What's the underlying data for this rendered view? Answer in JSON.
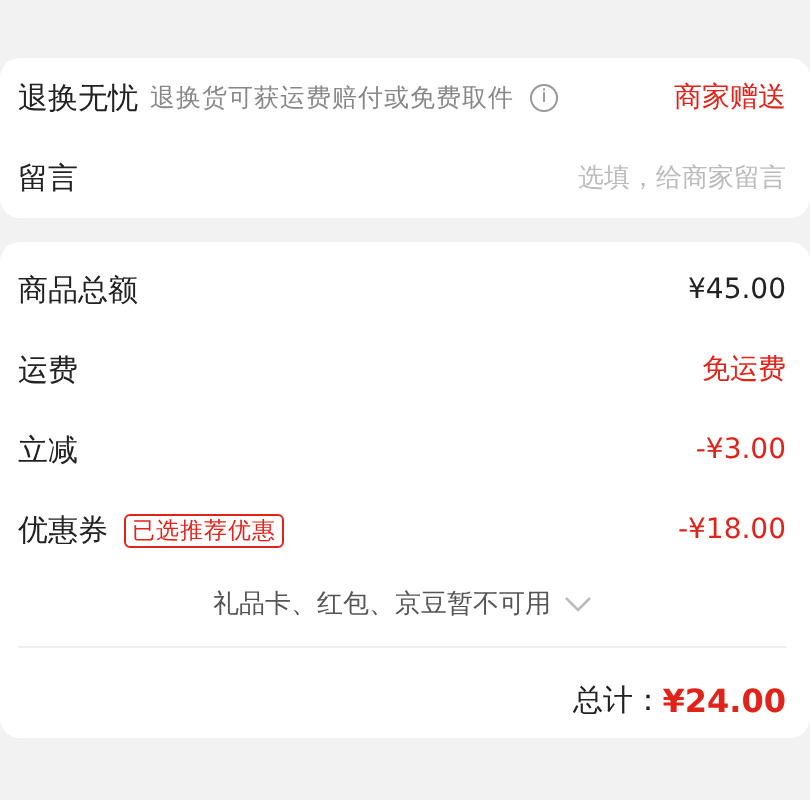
{
  "service": {
    "title": "退换无忧",
    "desc": "退换货可获运费赔付或免费取件",
    "info_icon": "i",
    "value": "商家赠送"
  },
  "message": {
    "label": "留言",
    "placeholder": "选填，给商家留言"
  },
  "summary": [
    {
      "label": "商品总额",
      "value": "¥45.00",
      "highlight": false
    },
    {
      "label": "运费",
      "value": "免运费",
      "highlight": true
    },
    {
      "label": "立减",
      "value": "-¥3.00",
      "highlight": true
    },
    {
      "label": "优惠券",
      "tag": "已选推荐优惠",
      "value": "-¥18.00",
      "highlight": true
    }
  ],
  "unavailable": {
    "text": "礼品卡、红包、京豆暂不可用",
    "expanded": false
  },
  "total": {
    "label": "总计：",
    "value": "¥24.00"
  }
}
